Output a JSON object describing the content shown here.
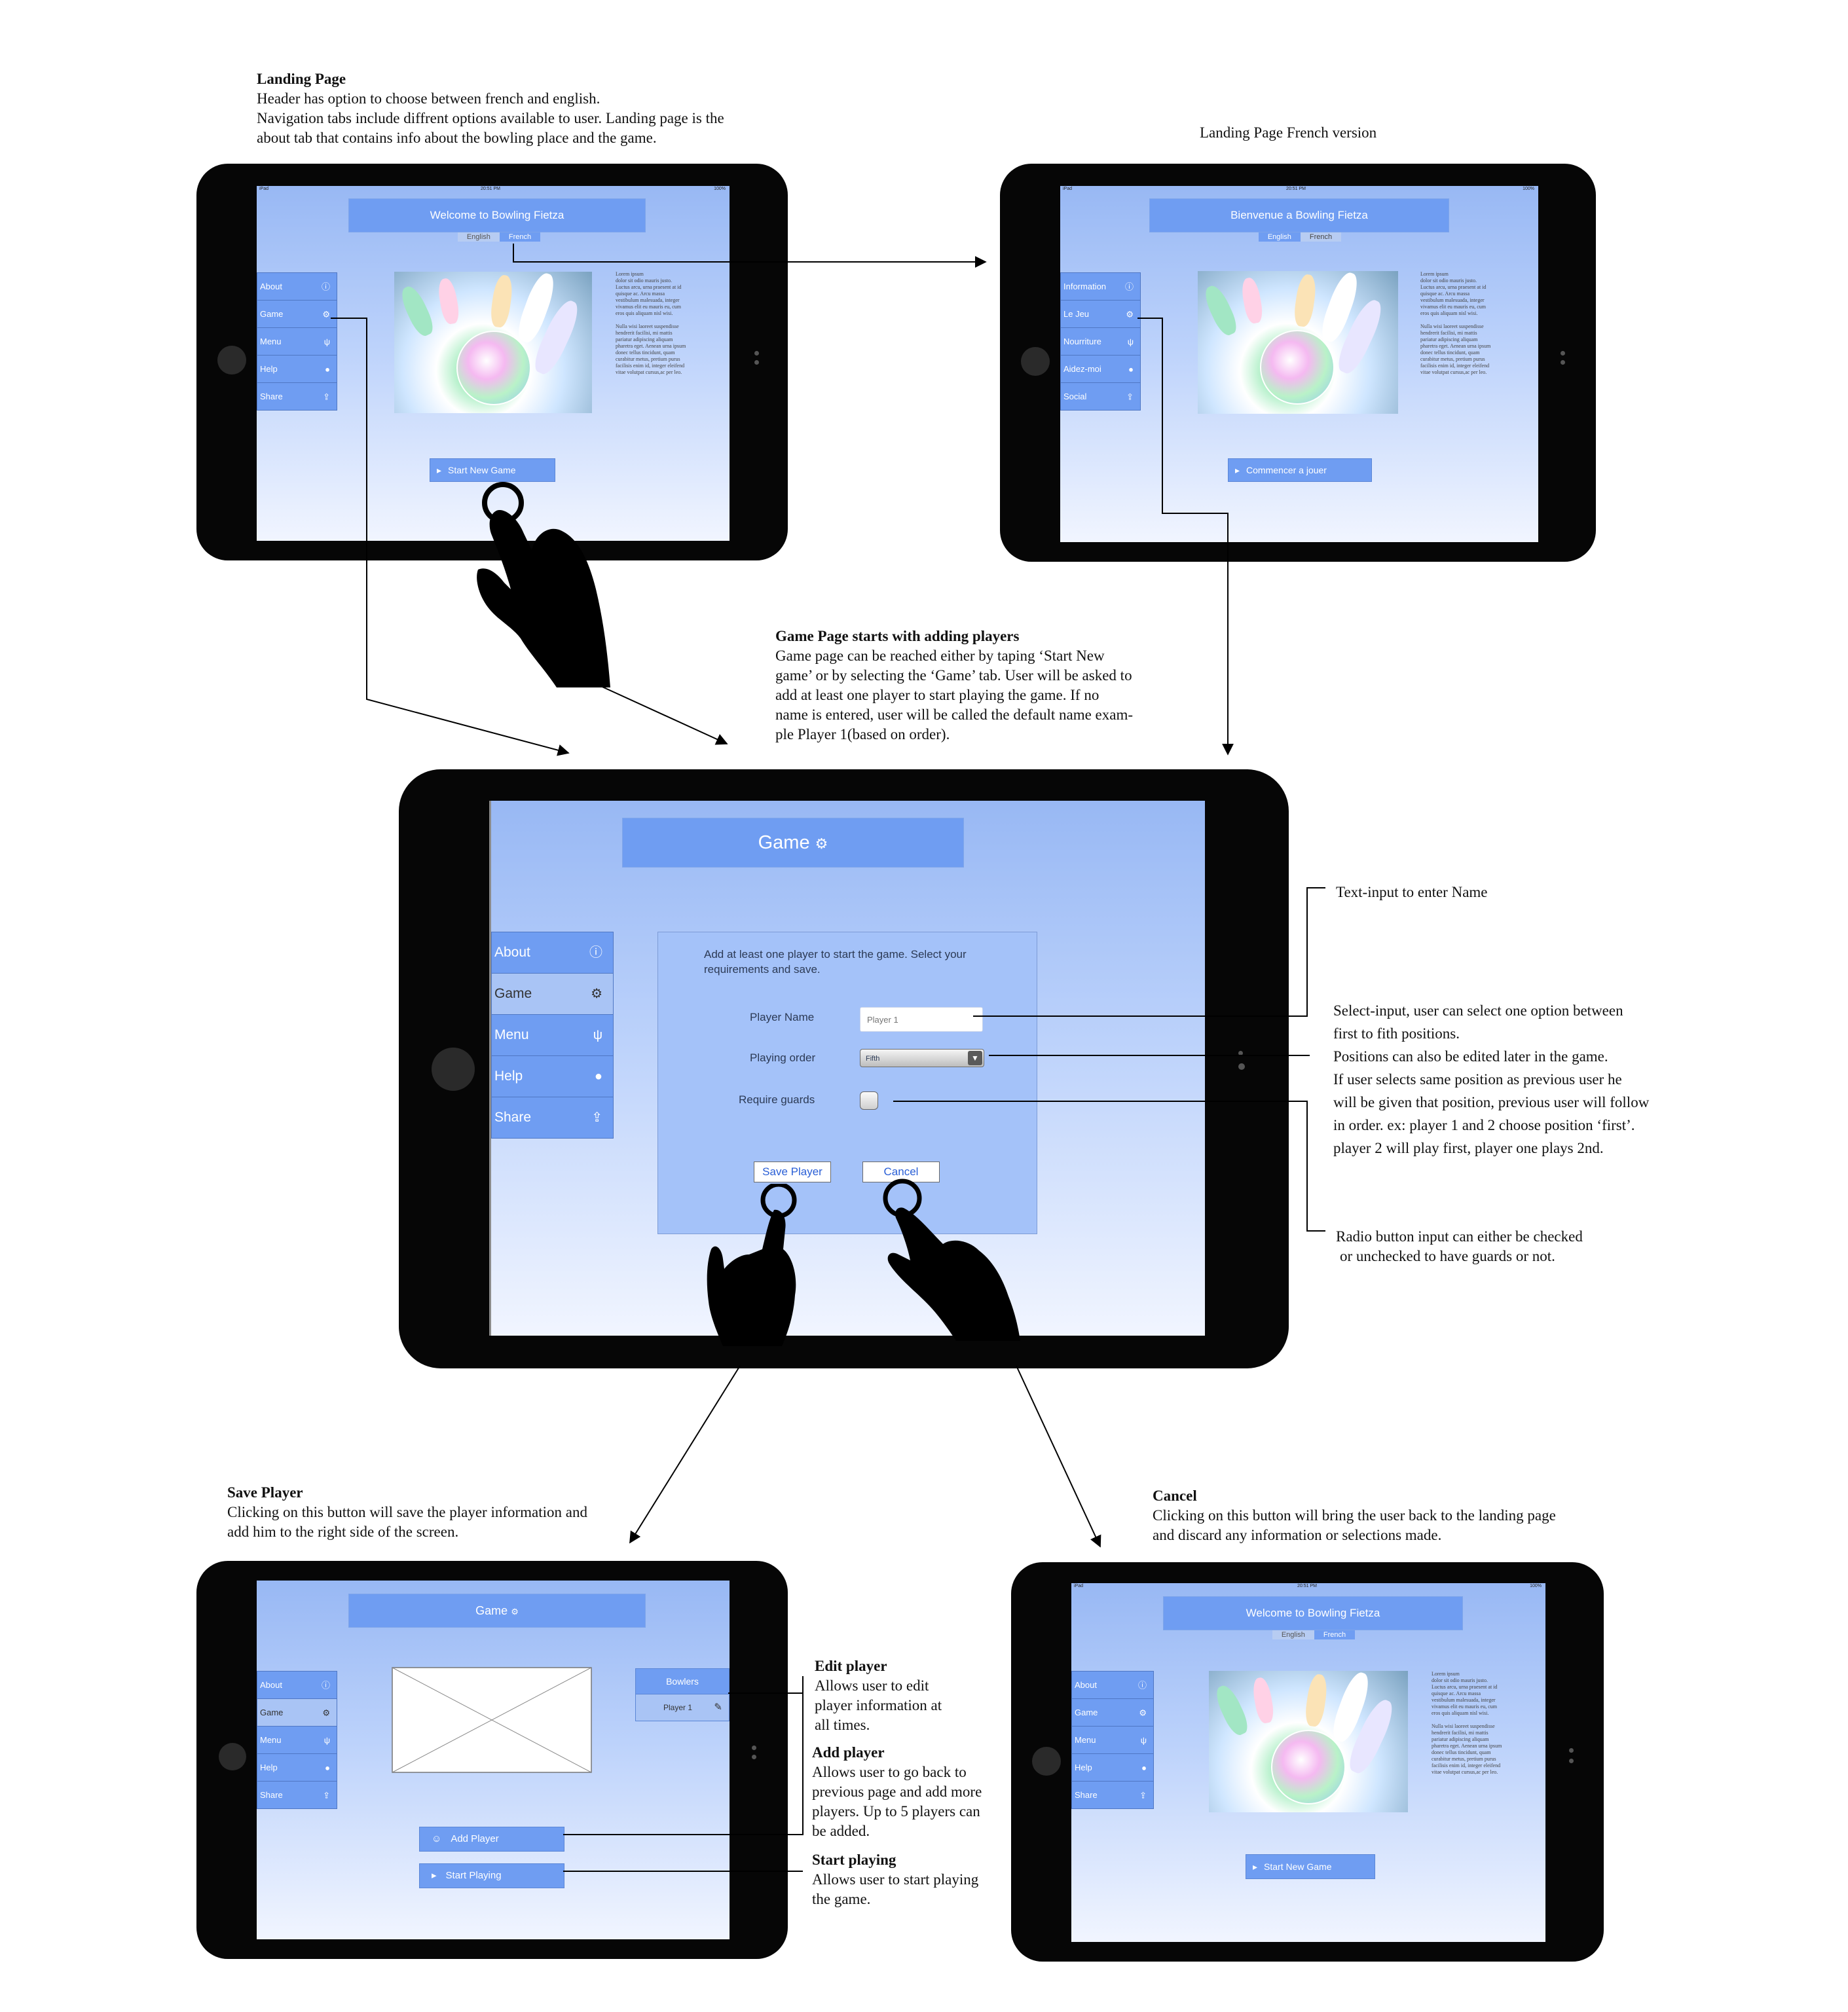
{
  "notes": {
    "landing": {
      "title": "Landing Page",
      "lines": [
        "Header has option to choose between french and english.",
        "Navigation tabs include diffrent options available to user. Landing page is the",
        "about tab that contains info about the bowling place and the game."
      ]
    },
    "french": {
      "title": "Landing Page French version"
    },
    "game": {
      "title": "Game Page starts with adding players",
      "lines": [
        "Game page can be reached either by taping ‘Start New",
        "game’ or by selecting the ‘Game’ tab. User will be asked to",
        "add at least one player to start playing the game. If no",
        "name is entered, user will be called the default name exam-",
        "ple Player 1(based on order)."
      ]
    },
    "text_input": "Text-input to enter Name",
    "select_input": {
      "lines": [
        "Select-input, user can select one option between",
        "first to fith positions.",
        "Positions can also be edited later in the game.",
        "If user selects same position as previous user he",
        "will be given that position, previous user will follow",
        "in order. ex: player 1 and 2 choose position ‘first’.",
        "player 2 will play first, player one plays 2nd."
      ]
    },
    "radio": {
      "lines": [
        "Radio button input can either be checked",
        "or unchecked to have guards or not."
      ]
    },
    "save": {
      "title": "Save Player",
      "lines": [
        "Clicking on this button will save the player information and",
        "add him to the right side of the screen."
      ]
    },
    "cancel": {
      "title": "Cancel",
      "lines": [
        "Clicking on this button will bring the user back to the landing page",
        "and discard any information or selections made."
      ]
    },
    "edit": {
      "title": "Edit player",
      "lines": [
        "Allows user to edit",
        "player information at",
        "all times."
      ]
    },
    "add": {
      "title": "Add player",
      "lines": [
        "Allows user to go back to",
        "previous page and add more",
        "players. Up to 5 players can",
        "be added."
      ]
    },
    "start": {
      "title": "Start playing",
      "lines": [
        "Allows user to start playing",
        "the game."
      ]
    }
  },
  "status": {
    "carrier": "iPad",
    "time": "20:51 PM",
    "battery": "100%"
  },
  "landing_en": {
    "header": "Welcome to Bowling Fietza",
    "lang_en": "English",
    "lang_fr": "French",
    "nav": [
      "About",
      "Game",
      "Menu",
      "Help",
      "Share"
    ],
    "button": "Start New Game",
    "lorem": [
      "Lorem ipsum",
      "dolor sit odio mauris justo.",
      "Luctus arcu, urna praesent at id",
      "quisque ac. Arcu massa",
      "vestibulum malesuada, integer",
      "vivamus elit eu mauris eu, cum",
      "eros quis aliquam nisl wisi.",
      "",
      "Nulla wisi laoreet suspendisse",
      "hendrerit facilisi, mi mattis",
      "pariatur adipiscing aliquam",
      "pharetra eget. Aenean urna ipsum",
      "donec tellus tincidunt, quam",
      "curabitur metus, pretium purus",
      "facilisis enim id, integer eleifend",
      "vitae volutpat cursus,ac per leo."
    ]
  },
  "landing_fr": {
    "header": "Bienvenue a Bowling Fietza",
    "lang_en": "English",
    "lang_fr": "French",
    "nav": [
      "Information",
      "Le Jeu",
      "Nourriture",
      "Aidez-moi",
      "Social"
    ],
    "button": "Commencer a jouer"
  },
  "game_page": {
    "header": "Game",
    "nav": [
      "About",
      "Game",
      "Menu",
      "Help",
      "Share"
    ],
    "instructions": "Add at least one player to start the game. Select your requirements and save.",
    "player_name_label": "Player Name",
    "player_name_placeholder": "Player 1",
    "order_label": "Playing order",
    "order_value": "Fifth",
    "guards_label": "Require guards",
    "save_label": "Save Player",
    "cancel_label": "Cancel"
  },
  "saved_page": {
    "header": "Game",
    "nav": [
      "About",
      "Game",
      "Menu",
      "Help",
      "Share"
    ],
    "bowlers_title": "Bowlers",
    "bowler": "Player 1",
    "add_label": "Add  Player",
    "start_label": "Start Playing"
  },
  "cancel_page": {
    "header": "Welcome to Bowling Fietza",
    "lang_en": "English",
    "lang_fr": "French",
    "nav": [
      "About",
      "Game",
      "Menu",
      "Help",
      "Share"
    ],
    "button": "Start New Game"
  },
  "icons": {
    "nav": [
      "info-icon",
      "gear-icon",
      "cutlery-icon",
      "help-icon",
      "share-icon"
    ]
  }
}
